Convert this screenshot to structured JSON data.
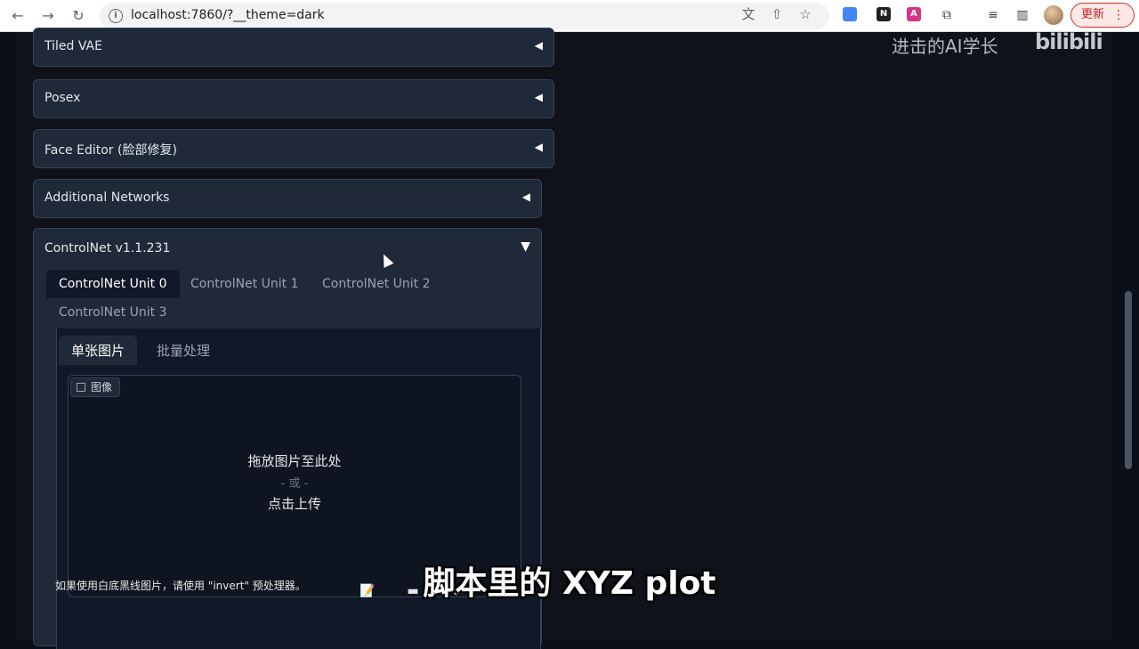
{
  "browser": {
    "url": "localhost:7860/?__theme=dark",
    "update_label": "更新",
    "menu_glyph": "⋮",
    "back_glyph": "←",
    "forward_glyph": "→",
    "reload_glyph": "↻",
    "info_glyph": "i",
    "translate_glyph": "文",
    "share_glyph": "⇧",
    "star_glyph": "☆",
    "extensions_glyph": "⧉",
    "media_glyph": "≡",
    "sidepanel_glyph": "▥",
    "ext_notion_glyph": "N",
    "ext_ai_glyph": "A"
  },
  "accordions": [
    {
      "title": "Tiled VAE",
      "arrow": "◀"
    },
    {
      "title": "Posex",
      "arrow": "◀"
    },
    {
      "title": "Face Editor (脸部修复)",
      "arrow": "◀"
    },
    {
      "title": "Additional Networks",
      "arrow": "◀"
    }
  ],
  "controlnet": {
    "title": "ControlNet v1.1.231",
    "arrow": "▼",
    "unit_tabs": [
      "ControlNet Unit 0",
      "ControlNet Unit 1",
      "ControlNet Unit 2",
      "ControlNet Unit 3"
    ],
    "sub_tabs": [
      "单张图片",
      "批量处理"
    ],
    "image_label": "图像",
    "drop_line1": "拖放图片至此处",
    "drop_or": "- 或 -",
    "drop_line2": "点击上传",
    "hint": "如果使用白底黑线图片，请使用 \"invert\" 预处理器。",
    "tools": [
      "📝",
      "▬",
      "⇄",
      "⮭"
    ]
  },
  "overlay": {
    "watermark": "进击的AI学长",
    "logo": "bilibili",
    "subtitle": "脚本里的 XYZ plot"
  },
  "colors": {
    "page_bg": "#0b0f19",
    "panel_bg": "#1f2937",
    "border": "#374151",
    "update_red": "#c5221f"
  }
}
